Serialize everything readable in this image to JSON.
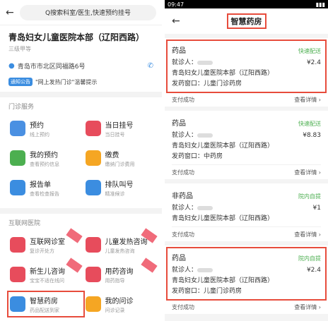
{
  "left": {
    "search_placeholder": "Q搜索科室/医生,快速预约挂号",
    "hospital_name": "青岛妇女儿童医院本部（辽阳西路）",
    "hospital_grade": "三级甲等",
    "address": "青岛市市北区同福路6号",
    "notice_tag": "通知公告",
    "notice_text": "\"网上发热门诊\"温馨提示",
    "section_outpatient": "门诊服务",
    "section_internet": "互联网医院",
    "outpatient_items": [
      {
        "title": "预约",
        "sub": "线上预约",
        "icon": "calendar-icon",
        "color": "#4a90e2"
      },
      {
        "title": "当日挂号",
        "sub": "当日挂号",
        "icon": "plus-icon",
        "color": "#e74c5c"
      },
      {
        "title": "我的预约",
        "sub": "查看预约信息",
        "icon": "clock-icon",
        "color": "#4caf50"
      },
      {
        "title": "缴费",
        "sub": "缴纳门诊费用",
        "icon": "wallet-icon",
        "color": "#f5a623"
      },
      {
        "title": "报告单",
        "sub": "查看检查报告",
        "icon": "report-icon",
        "color": "#3b8de0"
      },
      {
        "title": "排队叫号",
        "sub": "精准候诊",
        "icon": "speaker-icon",
        "color": "#3b8de0"
      }
    ],
    "internet_items": [
      {
        "title": "互联网诊室",
        "sub": "复诊开处方",
        "icon": "bag-icon",
        "color": "#e74c5c"
      },
      {
        "title": "儿童发热咨询",
        "sub": "儿童发热咨询",
        "icon": "chat-icon",
        "color": "#e74c5c"
      },
      {
        "title": "新生儿咨询",
        "sub": "宝宝不适在线问",
        "icon": "baby-icon",
        "color": "#e74c5c"
      },
      {
        "title": "用药咨询",
        "sub": "用药指导",
        "icon": "pill-icon",
        "color": "#e74c5c"
      },
      {
        "title": "智慧药房",
        "sub": "药品配送到家",
        "icon": "pharmacy-icon",
        "color": "#3b8de0"
      },
      {
        "title": "我的问诊",
        "sub": "问诊记录",
        "icon": "record-icon",
        "color": "#f5a623"
      }
    ]
  },
  "right": {
    "time": "09:47",
    "title": "智慧药房",
    "labels": {
      "patient": "就诊人：",
      "pay_ok": "支付成功",
      "details": "查看详情 ›"
    },
    "orders": [
      {
        "kind": "药品",
        "status": "快速配送",
        "hospital": "青岛妇女儿童医院本部（辽阳西路）",
        "price": "¥2.4",
        "window": "发药窗口：儿童门诊药房"
      },
      {
        "kind": "药品",
        "status": "快速配送",
        "hospital": "青岛妇女儿童医院本部（辽阳西路）",
        "price": "¥8.83",
        "window": "发药窗口：中药房"
      },
      {
        "kind": "非药品",
        "status": "院内自提",
        "hospital": "青岛妇女儿童医院本部（辽阳西路）",
        "price": "¥1",
        "window": ""
      },
      {
        "kind": "药品",
        "status": "院内自提",
        "hospital": "青岛妇女儿童医院本部（辽阳西路）",
        "price": "¥2.4",
        "window": "发药窗口：儿童门诊药房"
      }
    ]
  }
}
